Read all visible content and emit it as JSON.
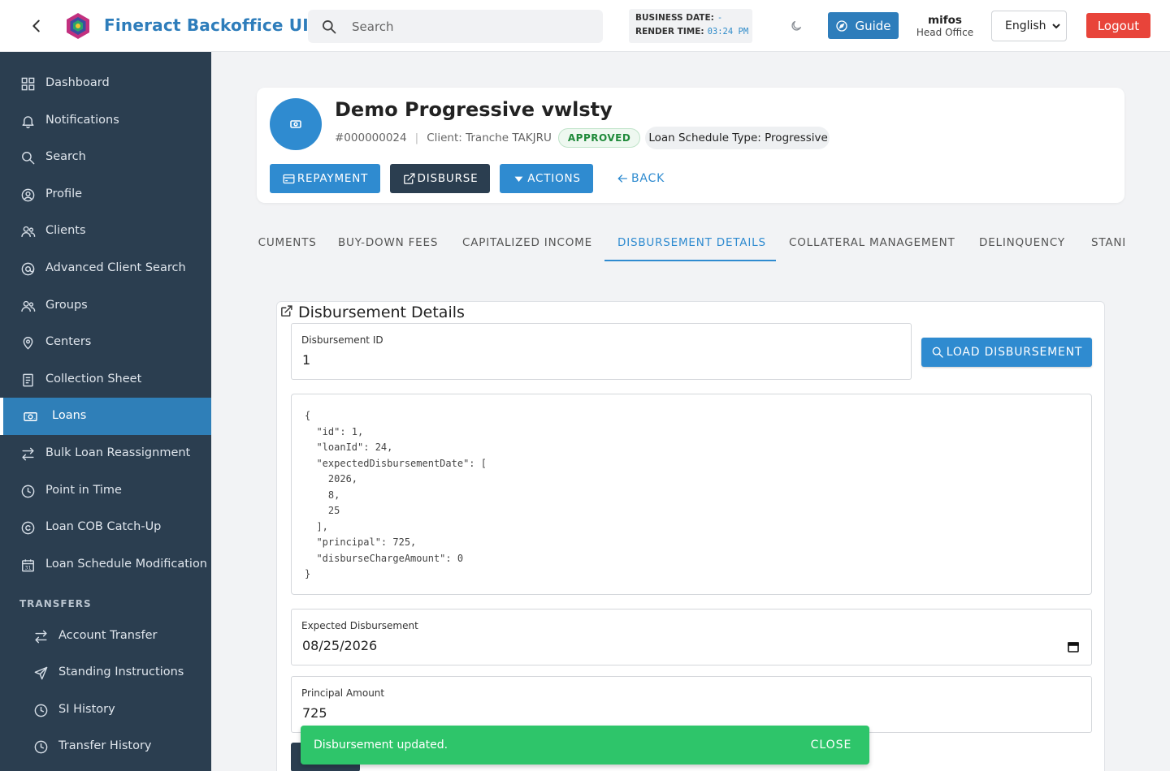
{
  "header": {
    "app_title": "Fineract Backoffice UI",
    "search_placeholder": "Search",
    "business_date_label": "BUSINESS DATE:",
    "business_date_value": "-",
    "render_time_label": "RENDER TIME:",
    "render_time_value": "03:24 PM",
    "guide_label": "Guide",
    "user_name": "mifos",
    "user_office": "Head Office",
    "language": "English",
    "logout_label": "Logout",
    "logo_icon": "hexagon-logo-icon",
    "accent_color": "#2e7dbb",
    "logout_color": "#e8443a"
  },
  "sidebar": {
    "items": [
      {
        "label": "Dashboard",
        "icon": "grid-icon"
      },
      {
        "label": "Notifications",
        "icon": "bell-icon"
      },
      {
        "label": "Search",
        "icon": "search-icon"
      },
      {
        "label": "Profile",
        "icon": "user-circle-icon"
      },
      {
        "label": "Clients",
        "icon": "users-icon"
      },
      {
        "label": "Advanced Client Search",
        "icon": "at-icon"
      },
      {
        "label": "Groups",
        "icon": "group-icon"
      },
      {
        "label": "Centers",
        "icon": "pin-icon"
      },
      {
        "label": "Collection Sheet",
        "icon": "sheet-icon"
      },
      {
        "label": "Loans",
        "icon": "money-icon"
      },
      {
        "label": "Bulk Loan Reassignment",
        "icon": "swap-icon"
      },
      {
        "label": "Point in Time",
        "icon": "clock-icon"
      },
      {
        "label": "Loan COB Catch-Up",
        "icon": "refresh-circle-icon"
      },
      {
        "label": "Loan Schedule Modification",
        "icon": "calendar-icon"
      }
    ],
    "active_item": "Loans",
    "section_title": "TRANSFERS",
    "transfer_items": [
      {
        "label": "Account Transfer",
        "icon": "swap-icon"
      },
      {
        "label": "Standing Instructions",
        "icon": "send-icon"
      },
      {
        "label": "SI History",
        "icon": "clock-icon"
      },
      {
        "label": "Transfer History",
        "icon": "clock-icon"
      }
    ],
    "bg_color": "#2b3e50",
    "active_color": "#2f7fb8"
  },
  "loan": {
    "title": "Demo Progressive vwlsty",
    "account_no": "#000000024",
    "client": "Client: Tranche TAKJRU",
    "status": "APPROVED",
    "schedule_type": "Loan Schedule Type: Progressive",
    "status_color": "#1f8a3a"
  },
  "actions": {
    "repayment": "REPAYMENT",
    "disburse": "DISBURSE",
    "actions": "ACTIONS",
    "back": "BACK"
  },
  "tabs": [
    {
      "label": "DOCUMENTS"
    },
    {
      "label": "BUY-DOWN FEES"
    },
    {
      "label": "CAPITALIZED INCOME"
    },
    {
      "label": "DISBURSEMENT DETAILS"
    },
    {
      "label": "COLLATERAL MANAGEMENT"
    },
    {
      "label": "DELINQUENCY"
    },
    {
      "label": "STANDING INSTRUCTIONS"
    }
  ],
  "active_tab": "DISBURSEMENT DETAILS",
  "details": {
    "title": "Disbursement Details",
    "disbursement_id_label": "Disbursement ID",
    "disbursement_id_value": "1",
    "load_label": "LOAD DISBURSEMENT",
    "json_text": "{\n  \"id\": 1,\n  \"loanId\": 24,\n  \"expectedDisbursementDate\": [\n    2026,\n    8,\n    25\n  ],\n  \"principal\": 725,\n  \"disburseChargeAmount\": 0\n}",
    "expected_label": "Expected Disbursement",
    "expected_value": "08/25/2026",
    "principal_label": "Principal Amount",
    "principal_value": "725"
  },
  "snackbar": {
    "message": "Disbursement updated.",
    "close_label": "CLOSE",
    "color": "#2ec56a"
  }
}
